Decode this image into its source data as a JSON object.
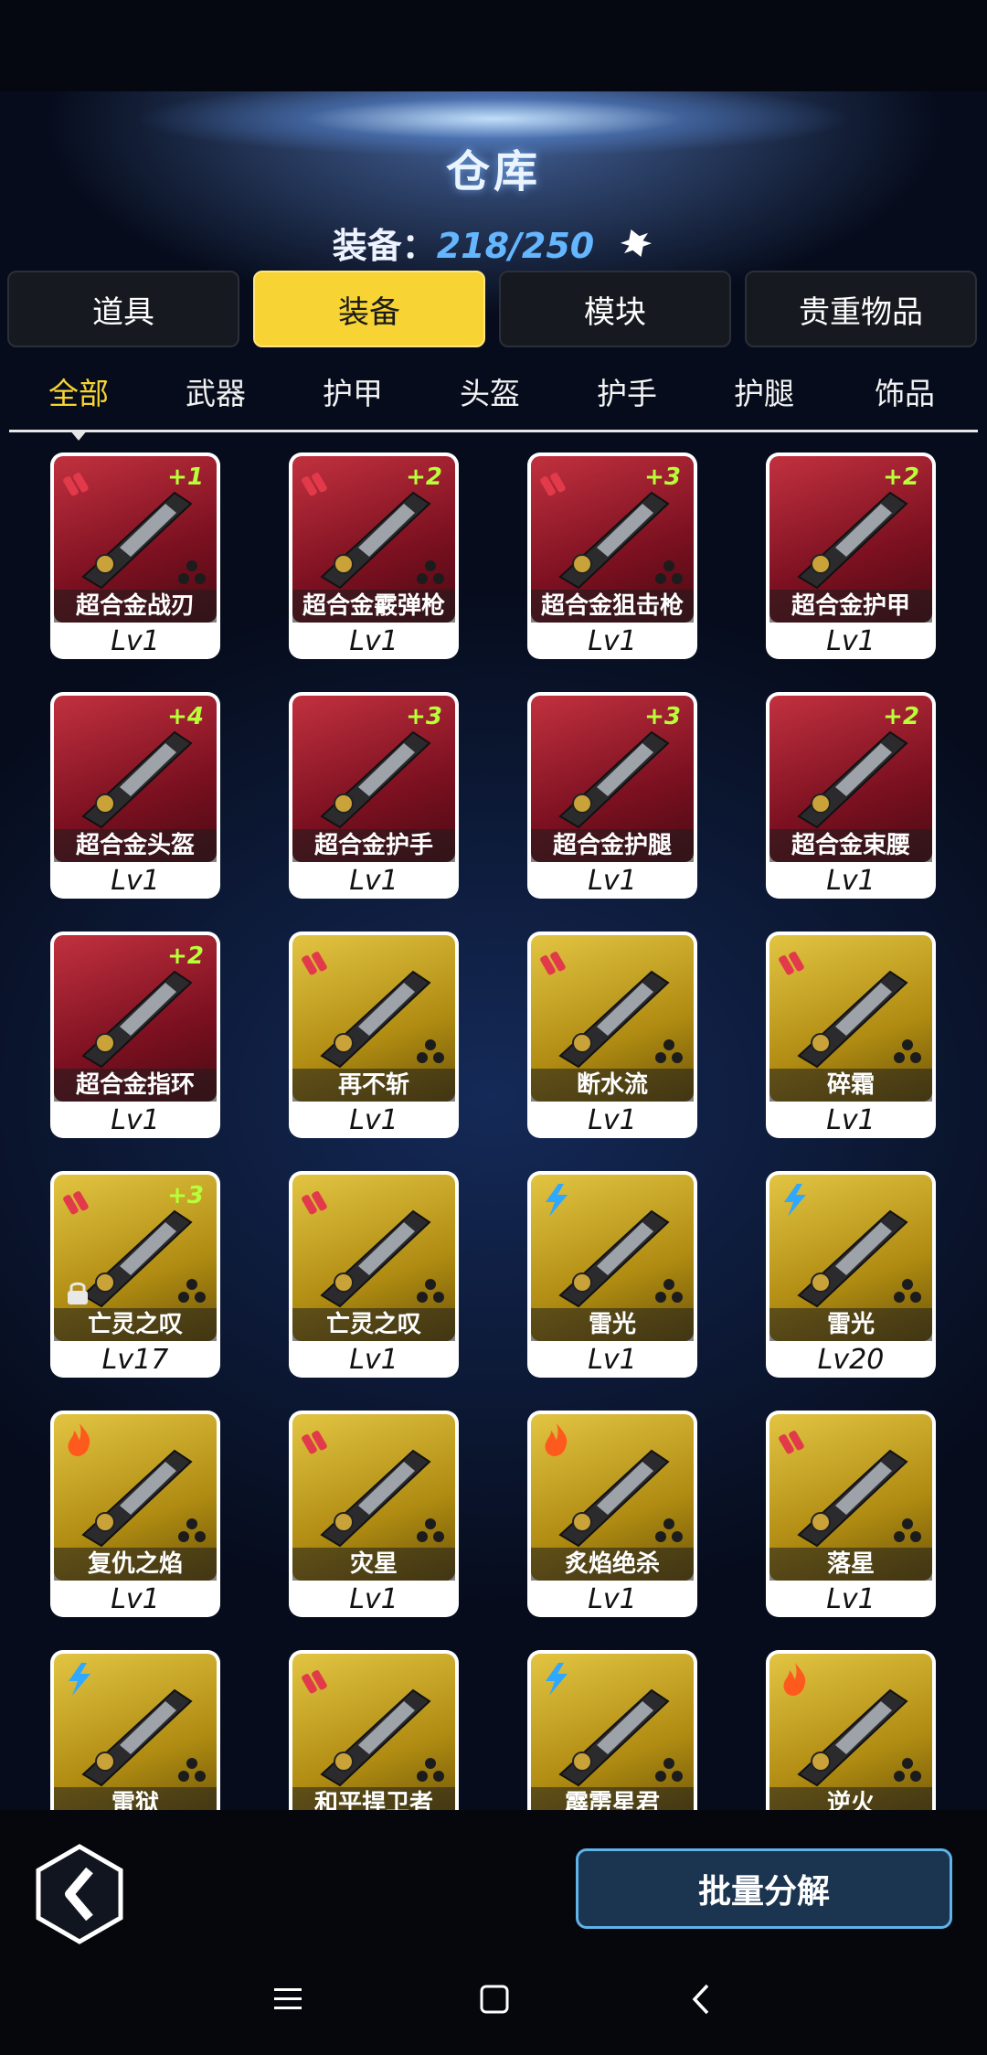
{
  "header": {
    "title": "仓库",
    "capacity_label": "装备：",
    "capacity_value": "218/250"
  },
  "tabs": [
    {
      "label": "道具",
      "active": false
    },
    {
      "label": "装备",
      "active": true
    },
    {
      "label": "模块",
      "active": false
    },
    {
      "label": "贵重物品",
      "active": false
    }
  ],
  "subtabs": [
    {
      "label": "全部",
      "active": true
    },
    {
      "label": "武器",
      "active": false
    },
    {
      "label": "护甲",
      "active": false
    },
    {
      "label": "头盔",
      "active": false
    },
    {
      "label": "护手",
      "active": false
    },
    {
      "label": "护腿",
      "active": false
    },
    {
      "label": "饰品",
      "active": false
    }
  ],
  "items": [
    {
      "name": "超合金战刃",
      "level": "Lv1",
      "plus": "+1",
      "rarity": "red",
      "type_icon": "bullet-icon",
      "item_icon": "blade-icon",
      "dots": true,
      "locked": false
    },
    {
      "name": "超合金霰弹枪",
      "level": "Lv1",
      "plus": "+2",
      "rarity": "red",
      "type_icon": "bullet-icon",
      "item_icon": "shotgun-icon",
      "dots": true,
      "locked": false
    },
    {
      "name": "超合金狙击枪",
      "level": "Lv1",
      "plus": "+3",
      "rarity": "red",
      "type_icon": "bullet-icon",
      "item_icon": "sniper-rifle-icon",
      "dots": true,
      "locked": false
    },
    {
      "name": "超合金护甲",
      "level": "Lv1",
      "plus": "+2",
      "rarity": "red",
      "type_icon": "",
      "item_icon": "armor-icon",
      "dots": false,
      "locked": false
    },
    {
      "name": "超合金头盔",
      "level": "Lv1",
      "plus": "+4",
      "rarity": "red",
      "type_icon": "",
      "item_icon": "helmet-icon",
      "dots": false,
      "locked": false
    },
    {
      "name": "超合金护手",
      "level": "Lv1",
      "plus": "+3",
      "rarity": "red",
      "type_icon": "",
      "item_icon": "gauntlet-icon",
      "dots": false,
      "locked": false
    },
    {
      "name": "超合金护腿",
      "level": "Lv1",
      "plus": "+3",
      "rarity": "red",
      "type_icon": "",
      "item_icon": "leg-armor-icon",
      "dots": false,
      "locked": false
    },
    {
      "name": "超合金束腰",
      "level": "Lv1",
      "plus": "+2",
      "rarity": "red",
      "type_icon": "",
      "item_icon": "belt-icon",
      "dots": false,
      "locked": false
    },
    {
      "name": "超合金指环",
      "level": "Lv1",
      "plus": "+2",
      "rarity": "red",
      "type_icon": "",
      "item_icon": "ring-icon",
      "dots": false,
      "locked": false
    },
    {
      "name": "再不斩",
      "level": "Lv1",
      "plus": "",
      "rarity": "gold",
      "type_icon": "bullet-icon",
      "item_icon": "cleaver-icon",
      "dots": true,
      "locked": false
    },
    {
      "name": "断水流",
      "level": "Lv1",
      "plus": "",
      "rarity": "gold",
      "type_icon": "bullet-icon",
      "item_icon": "katana-icon",
      "dots": true,
      "locked": false
    },
    {
      "name": "碎霜",
      "level": "Lv1",
      "plus": "",
      "rarity": "gold",
      "type_icon": "bullet-icon",
      "item_icon": "frost-blade-icon",
      "dots": true,
      "locked": false
    },
    {
      "name": "亡灵之叹",
      "level": "Lv17",
      "plus": "+3",
      "rarity": "gold",
      "type_icon": "bullet-icon",
      "item_icon": "serrated-sword-icon",
      "dots": true,
      "locked": true
    },
    {
      "name": "亡灵之叹",
      "level": "Lv1",
      "plus": "",
      "rarity": "gold",
      "type_icon": "bullet-icon",
      "item_icon": "serrated-sword-icon",
      "dots": true,
      "locked": false
    },
    {
      "name": "雷光",
      "level": "Lv1",
      "plus": "",
      "rarity": "gold",
      "type_icon": "lightning-icon",
      "item_icon": "lightning-staff-icon",
      "dots": true,
      "locked": false
    },
    {
      "name": "雷光",
      "level": "Lv20",
      "plus": "",
      "rarity": "gold",
      "type_icon": "lightning-icon",
      "item_icon": "lightning-staff-icon",
      "dots": true,
      "locked": false
    },
    {
      "name": "复仇之焰",
      "level": "Lv1",
      "plus": "",
      "rarity": "gold",
      "type_icon": "flame-icon",
      "item_icon": "flamethrower-icon",
      "dots": true,
      "locked": false
    },
    {
      "name": "灾星",
      "level": "Lv1",
      "plus": "",
      "rarity": "gold",
      "type_icon": "bullet-icon",
      "item_icon": "heavy-gun-icon",
      "dots": true,
      "locked": false
    },
    {
      "name": "炙焰绝杀",
      "level": "Lv1",
      "plus": "",
      "rarity": "gold",
      "type_icon": "flame-icon",
      "item_icon": "flame-cannon-icon",
      "dots": true,
      "locked": false
    },
    {
      "name": "落星",
      "level": "Lv1",
      "plus": "",
      "rarity": "gold",
      "type_icon": "bullet-icon",
      "item_icon": "blaster-icon",
      "dots": true,
      "locked": false
    },
    {
      "name": "雷狱",
      "level": "",
      "plus": "",
      "rarity": "gold",
      "type_icon": "lightning-icon",
      "item_icon": "lightning-gun-icon",
      "dots": true,
      "locked": false
    },
    {
      "name": "和平捍卫者",
      "level": "",
      "plus": "",
      "rarity": "gold",
      "type_icon": "bullet-icon",
      "item_icon": "launcher-icon",
      "dots": true,
      "locked": false
    },
    {
      "name": "霹雳星君",
      "level": "",
      "plus": "",
      "rarity": "gold",
      "type_icon": "lightning-icon",
      "item_icon": "thunder-rifle-icon",
      "dots": true,
      "locked": false
    },
    {
      "name": "逆火",
      "level": "",
      "plus": "",
      "rarity": "gold",
      "type_icon": "flame-icon",
      "item_icon": "fire-gun-icon",
      "dots": true,
      "locked": false
    }
  ],
  "footer": {
    "batch_label": "批量分解"
  },
  "colors": {
    "active_tab": "#f7d433",
    "plus_level": "#b8ff3a",
    "capacity_value": "#64b6ff",
    "card_red": "#a01c2c",
    "card_gold": "#c9a420"
  }
}
